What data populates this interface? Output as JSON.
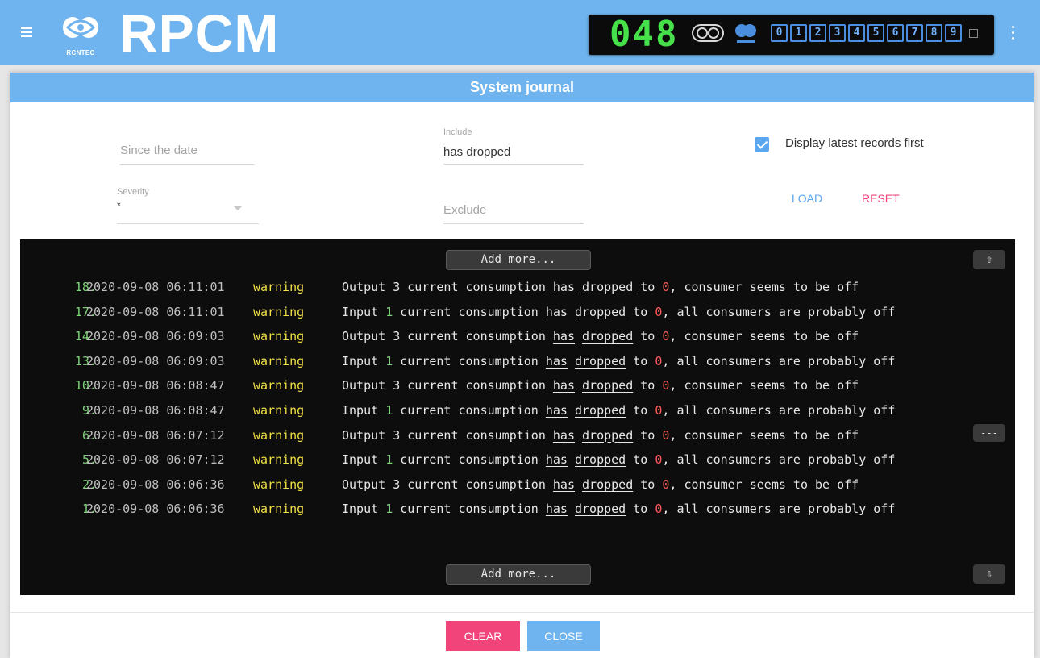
{
  "app": {
    "logo_text": "RPCM",
    "brand_small": "RCNTEC",
    "counter": "048",
    "channels": [
      "0",
      "1",
      "2",
      "3",
      "4",
      "5",
      "6",
      "7",
      "8",
      "9"
    ]
  },
  "dialog": {
    "title": "System journal",
    "since_date": {
      "placeholder": "Since the date",
      "value": ""
    },
    "include": {
      "label": "Include",
      "value": "has dropped"
    },
    "severity": {
      "label": "Severity",
      "value": "*"
    },
    "exclude": {
      "placeholder": "Exclude",
      "value": ""
    },
    "latest_first": {
      "checked": true,
      "label": "Display latest records first"
    },
    "load_label": "LOAD",
    "reset_label": "RESET",
    "add_more_label": "Add more...",
    "scroll_up_glyph": "⇧",
    "scroll_down_glyph": "⇩",
    "ellipsis_label": "---",
    "clear_label": "CLEAR",
    "close_label": "CLOSE"
  },
  "journal": [
    {
      "num": "18.",
      "datetime": "2020-09-08 06:11:01",
      "severity": "warning",
      "kind": "Output",
      "index": "3",
      "tail": "consumer seems to be off"
    },
    {
      "num": "17.",
      "datetime": "2020-09-08 06:11:01",
      "severity": "warning",
      "kind": "Input",
      "index": "1",
      "tail": "all consumers are probably off"
    },
    {
      "num": "14.",
      "datetime": "2020-09-08 06:09:03",
      "severity": "warning",
      "kind": "Output",
      "index": "3",
      "tail": "consumer seems to be off"
    },
    {
      "num": "13.",
      "datetime": "2020-09-08 06:09:03",
      "severity": "warning",
      "kind": "Input",
      "index": "1",
      "tail": "all consumers are probably off"
    },
    {
      "num": "10.",
      "datetime": "2020-09-08 06:08:47",
      "severity": "warning",
      "kind": "Output",
      "index": "3",
      "tail": "consumer seems to be off"
    },
    {
      "num": "9.",
      "datetime": "2020-09-08 06:08:47",
      "severity": "warning",
      "kind": "Input",
      "index": "1",
      "tail": "all consumers are probably off"
    },
    {
      "num": "6.",
      "datetime": "2020-09-08 06:07:12",
      "severity": "warning",
      "kind": "Output",
      "index": "3",
      "tail": "consumer seems to be off"
    },
    {
      "num": "5.",
      "datetime": "2020-09-08 06:07:12",
      "severity": "warning",
      "kind": "Input",
      "index": "1",
      "tail": "all consumers are probably off"
    },
    {
      "num": "2.",
      "datetime": "2020-09-08 06:06:36",
      "severity": "warning",
      "kind": "Output",
      "index": "3",
      "tail": "consumer seems to be off"
    },
    {
      "num": "1.",
      "datetime": "2020-09-08 06:06:36",
      "severity": "warning",
      "kind": "Input",
      "index": "1",
      "tail": "all consumers are probably off"
    }
  ],
  "message_parts": {
    "p1": "current consumption",
    "has": "has",
    "dropped": "dropped",
    "to": "to",
    "zero": "0"
  },
  "colors": {
    "app_bar": "#6fb4ee",
    "clear_button": "#f0447b",
    "close_button": "#6fb4ee",
    "warning": "#f0e046",
    "line_number": "#7fd27a",
    "zero_value": "#ff5a5a",
    "counter": "#46e04a"
  }
}
